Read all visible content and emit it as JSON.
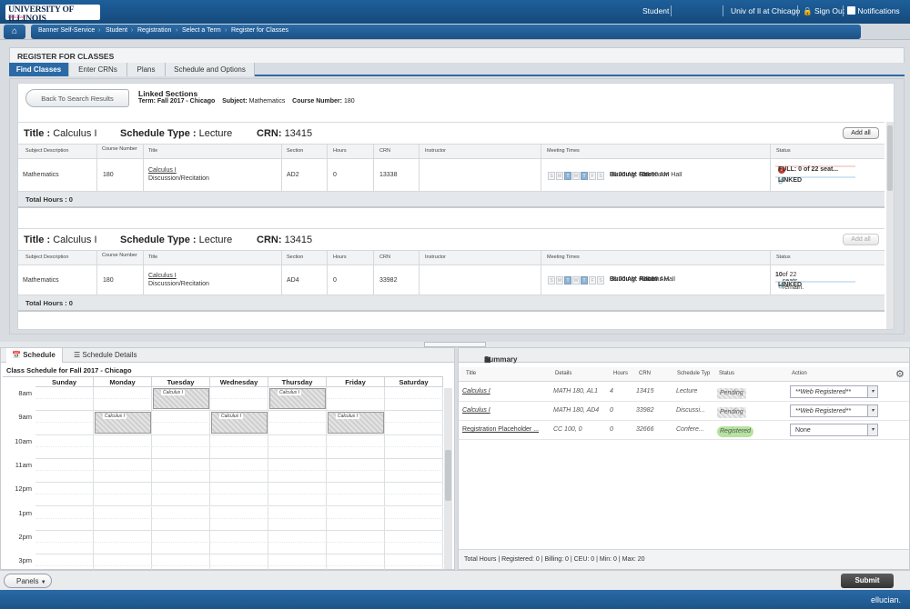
{
  "topbar": {
    "logo_text": "UNIVERSITY OF ILLINOIS",
    "logo_sub": "CHICAGO",
    "student_label": "Student",
    "campus_label": "Univ of Il at Chicago",
    "signout_label": "Sign Out",
    "notifications_label": "Notifications"
  },
  "breadcrumb": [
    "Banner Self-Service",
    "Student",
    "Registration",
    "Select a Term",
    "Register for Classes"
  ],
  "page": {
    "title": "REGISTER FOR CLASSES",
    "tabs": [
      "Find Classes",
      "Enter CRNs",
      "Plans",
      "Schedule and Options"
    ]
  },
  "linked": {
    "back_label": "Back To Search Results",
    "heading": "Linked Sections",
    "term_label": "Term:",
    "term_value": "Fall 2017 - Chicago",
    "subject_label": "Subject:",
    "subject_value": "Mathematics",
    "course_label": "Course Number:",
    "course_value": "180"
  },
  "columns": [
    "Subject Description",
    "Course Number",
    "Title",
    "Section",
    "Hours",
    "CRN",
    "Instructor",
    "Meeting Times",
    "Status"
  ],
  "sections": [
    {
      "title_label": "Title :",
      "title_value": "Calculus I",
      "type_label": "Schedule Type :",
      "type_value": "Lecture",
      "crn_label": "CRN:",
      "crn_value": "13415",
      "addall_label": "Add all",
      "row": {
        "subject": "Mathematics",
        "course": "180",
        "title_link": "Calculus I",
        "title_sub": "Discussion/Recitation",
        "section": "AD2",
        "hours": "0",
        "crn": "13338",
        "instructor": "",
        "days": [
          "S",
          "M",
          "T",
          "W",
          "T",
          "F",
          "S"
        ],
        "time": "09:00 AM - 09:50 AM",
        "building_label": "Building:",
        "building": "Stevenson Hall",
        "room_label": "Roo",
        "status_main": "FULL: 0 of 22 seat...",
        "status_linked": "LINKED"
      },
      "total_label": "Total Hours : 0"
    },
    {
      "title_label": "Title :",
      "title_value": "Calculus I",
      "type_label": "Schedule Type :",
      "type_value": "Lecture",
      "crn_label": "CRN:",
      "crn_value": "13415",
      "addall_label": "Add all",
      "row": {
        "subject": "Mathematics",
        "course": "180",
        "title_link": "Calculus I",
        "title_sub": "Discussion/Recitation",
        "section": "AD4",
        "hours": "0",
        "crn": "33982",
        "instructor": "",
        "days": [
          "S",
          "M",
          "T",
          "W",
          "T",
          "F",
          "S"
        ],
        "time": "08:00 AM - 08:50 AM",
        "building_label": "Building:",
        "building": "Addams Hall",
        "room_label": "Room",
        "status_seats_num": "10",
        "status_seats_rest": " of 22 seats remain.",
        "status_linked": "LINKED"
      },
      "total_label": "Total Hours : 0"
    }
  ],
  "schedule": {
    "tab_schedule": "Schedule",
    "tab_details": "Schedule Details",
    "caption": "Class Schedule for Fall 2017 - Chicago",
    "days": [
      "Sunday",
      "Monday",
      "Tuesday",
      "Wednesday",
      "Thursday",
      "Friday",
      "Saturday"
    ],
    "hours": [
      "8am",
      "9am",
      "10am",
      "11am",
      "12pm",
      "1pm",
      "2pm",
      "3pm"
    ],
    "block_label": "Calculus I"
  },
  "summary": {
    "title": "Summary",
    "columns": [
      "Title",
      "Details",
      "Hours",
      "CRN",
      "Schedule Typ",
      "Status",
      "Action"
    ],
    "rows": [
      {
        "title": "Calculus I",
        "details": "MATH 180, AL1",
        "hours": "4",
        "crn": "13415",
        "type": "Lecture",
        "status": "Pending",
        "action": "**Web Registered**"
      },
      {
        "title": "Calculus I",
        "details": "MATH 180, AD4",
        "hours": "0",
        "crn": "33982",
        "type": "Discussi...",
        "status": "Pending",
        "action": "**Web Registered**"
      },
      {
        "title": "Registration Placeholder ...",
        "details": "CC 100, 0",
        "hours": "0",
        "crn": "32666",
        "type": "Confere...",
        "status": "Registered",
        "action": "None"
      }
    ],
    "footer": "Total Hours | Registered: 0 | Billing: 0 | CEU: 0 | Min: 0 | Max: 20"
  },
  "bottombar": {
    "panels_label": "Panels",
    "submit_label": "Submit"
  },
  "footer_brand": "ellucian."
}
